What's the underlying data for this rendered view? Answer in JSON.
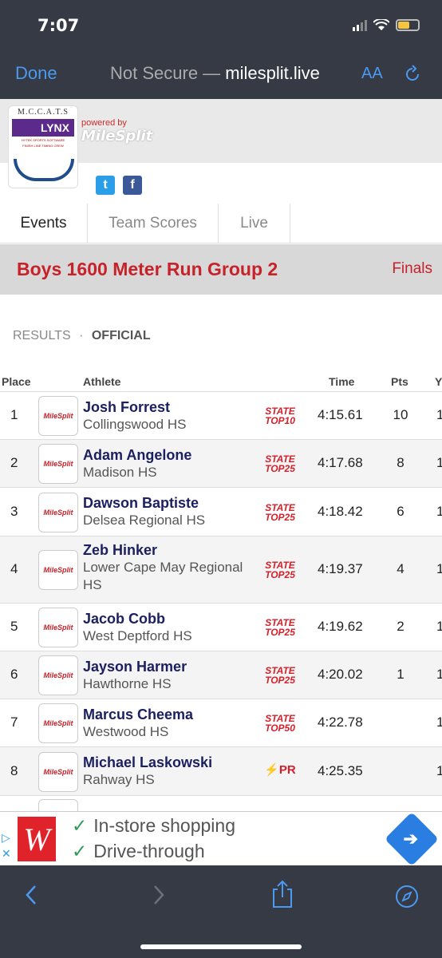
{
  "status": {
    "time": "7:07"
  },
  "browser": {
    "done_label": "Done",
    "url_prefix": "Not Secure —",
    "url_domain": "milesplit.live",
    "aa_label": "AA"
  },
  "header": {
    "logo_top": "M.C.C.A.T.S",
    "logo_name": "LYNX",
    "logo_sub1": "HYTEK SPORTS SOFTWARE",
    "logo_sub2": "FINISH LINE TIMING CREW",
    "powered_by": "powered by",
    "powered_brand": "MileSplit"
  },
  "tabs": [
    {
      "label": "Events"
    },
    {
      "label": "Team Scores"
    },
    {
      "label": "Live"
    }
  ],
  "event": {
    "name": "Boys 1600 Meter Run Group 2",
    "round": "Finals"
  },
  "results": {
    "label": "RESULTS",
    "sep": "·",
    "status": "OFFICIAL"
  },
  "table": {
    "headers": {
      "place": "Place",
      "athlete": "Athlete",
      "time": "Time",
      "pts": "Pts",
      "yr": "Y"
    },
    "badge_text": "MileSplit",
    "rows": [
      {
        "place": "1",
        "name": "Josh Forrest",
        "school": "Collingswood HS",
        "rank1": "STATE",
        "rank2": "TOP10",
        "time": "4:15.61",
        "pts": "10",
        "yr": "1"
      },
      {
        "place": "2",
        "name": "Adam Angelone",
        "school": "Madison HS",
        "rank1": "STATE",
        "rank2": "TOP25",
        "time": "4:17.68",
        "pts": "8",
        "yr": "1"
      },
      {
        "place": "3",
        "name": "Dawson Baptiste",
        "school": "Delsea Regional HS",
        "rank1": "STATE",
        "rank2": "TOP25",
        "time": "4:18.42",
        "pts": "6",
        "yr": "1"
      },
      {
        "place": "4",
        "name": "Zeb Hinker",
        "school": "Lower Cape May Regional HS",
        "rank1": "STATE",
        "rank2": "TOP25",
        "time": "4:19.37",
        "pts": "4",
        "yr": "1"
      },
      {
        "place": "5",
        "name": "Jacob Cobb",
        "school": "West Deptford HS",
        "rank1": "STATE",
        "rank2": "TOP25",
        "time": "4:19.62",
        "pts": "2",
        "yr": "1"
      },
      {
        "place": "6",
        "name": "Jayson Harmer",
        "school": "Hawthorne HS",
        "rank1": "STATE",
        "rank2": "TOP25",
        "time": "4:20.02",
        "pts": "1",
        "yr": "1"
      },
      {
        "place": "7",
        "name": "Marcus Cheema",
        "school": "Westwood HS",
        "rank1": "STATE",
        "rank2": "TOP50",
        "time": "4:22.78",
        "pts": "",
        "yr": "1"
      },
      {
        "place": "8",
        "name": "Michael Laskowski",
        "school": "Rahway HS",
        "rank1": "PR",
        "rank2": "",
        "time": "4:25.35",
        "pts": "",
        "yr": "1"
      }
    ]
  },
  "ad": {
    "logo_letter": "W",
    "line1": "In-store shopping",
    "line2": "Drive-through"
  }
}
